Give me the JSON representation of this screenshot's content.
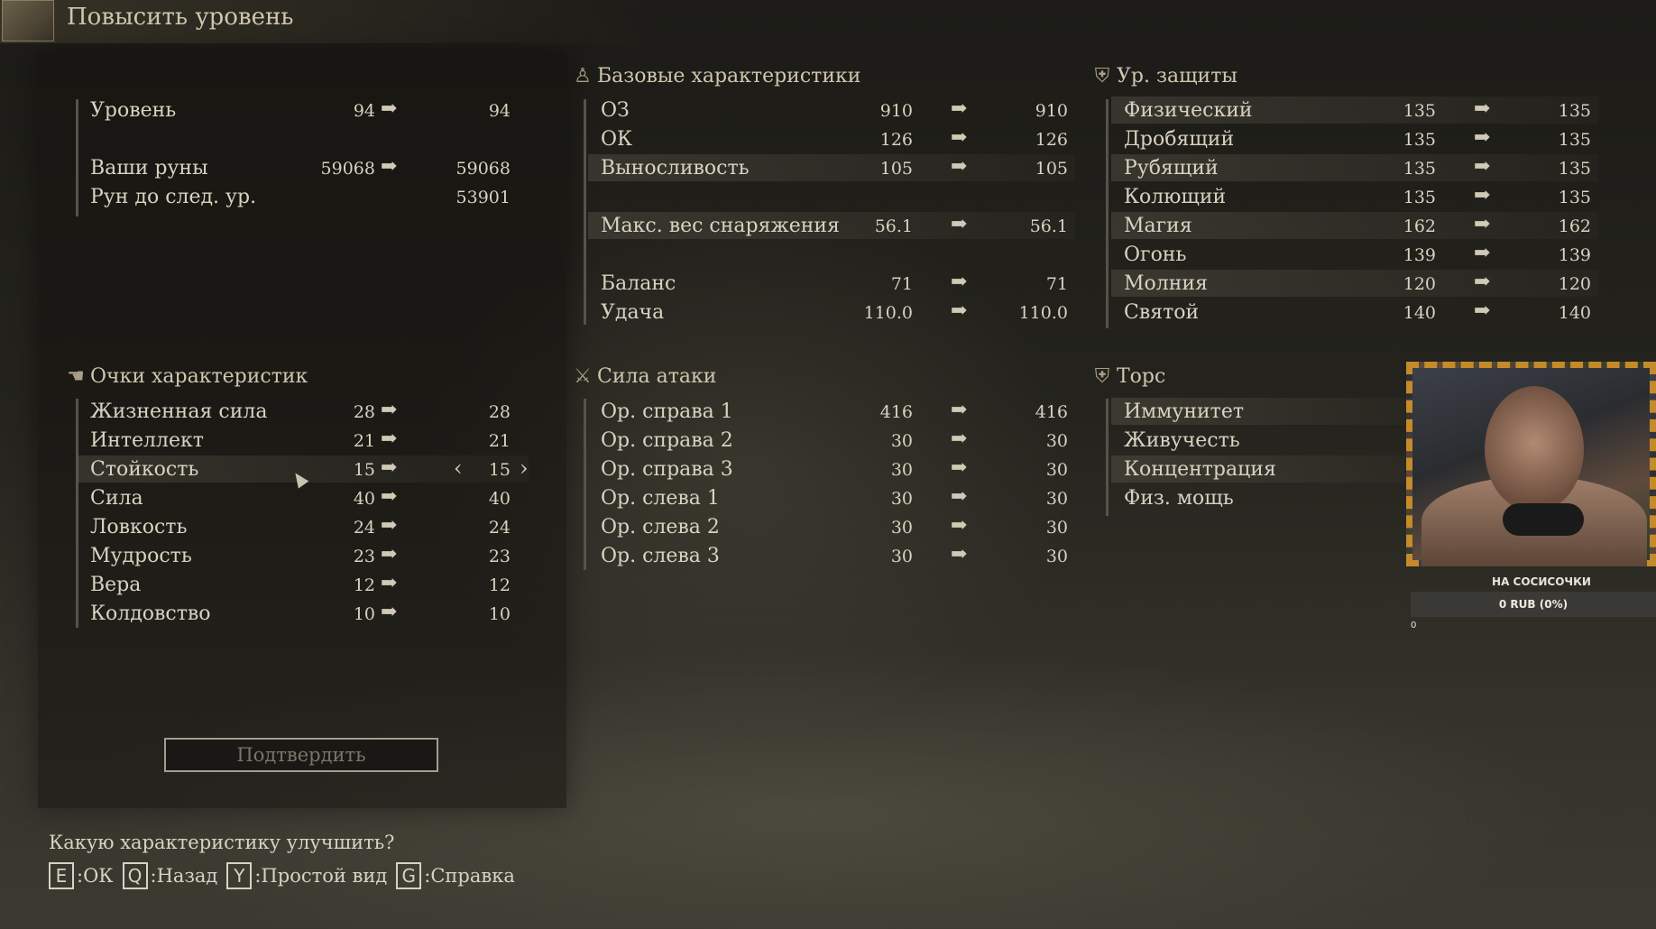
{
  "title": "Повысить уровень",
  "arrow": "➡",
  "level_section": {
    "rows": [
      {
        "label": "Уровень",
        "current": "94",
        "next": "94"
      },
      {
        "label": "Ваши руны",
        "current": "59068",
        "next": "59068"
      },
      {
        "label": "Рун до след. ур.",
        "next": "53901"
      }
    ]
  },
  "attributes": {
    "header": "Очки характеристик",
    "rows": [
      {
        "label": "Жизненная сила",
        "current": "28",
        "next": "28"
      },
      {
        "label": "Интеллект",
        "current": "21",
        "next": "21"
      },
      {
        "label": "Стойкость",
        "current": "15",
        "next": "15"
      },
      {
        "label": "Сила",
        "current": "40",
        "next": "40"
      },
      {
        "label": "Ловкость",
        "current": "24",
        "next": "24"
      },
      {
        "label": "Мудрость",
        "current": "23",
        "next": "23"
      },
      {
        "label": "Вера",
        "current": "12",
        "next": "12"
      },
      {
        "label": "Колдовство",
        "current": "10",
        "next": "10"
      }
    ],
    "selected_index": 2,
    "left_arrow": "‹",
    "right_arrow": "›"
  },
  "confirm_label": "Подтвердить",
  "base_stats": {
    "header": "Базовые характеристики",
    "rows": [
      {
        "label": "ОЗ",
        "current": "910",
        "next": "910"
      },
      {
        "label": "ОК",
        "current": "126",
        "next": "126"
      },
      {
        "label": "Выносливость",
        "current": "105",
        "next": "105"
      },
      {
        "label": "Макс. вес снаряжения",
        "current": "56.1",
        "next": "56.1"
      },
      {
        "label": "Баланс",
        "current": "71",
        "next": "71"
      },
      {
        "label": "Удача",
        "current": "110.0",
        "next": "110.0"
      }
    ]
  },
  "attack_power": {
    "header": "Сила атаки",
    "rows": [
      {
        "label": "Ор. справа 1",
        "current": "416",
        "next": "416"
      },
      {
        "label": "Ор. справа 2",
        "current": "30",
        "next": "30"
      },
      {
        "label": "Ор. справа 3",
        "current": "30",
        "next": "30"
      },
      {
        "label": "Ор. слева 1",
        "current": "30",
        "next": "30"
      },
      {
        "label": "Ор. слева 2",
        "current": "30",
        "next": "30"
      },
      {
        "label": "Ор. слева 3",
        "current": "30",
        "next": "30"
      }
    ]
  },
  "defense": {
    "header": "Ур. защиты",
    "rows": [
      {
        "label": "Физический",
        "current": "135",
        "next": "135"
      },
      {
        "label": "Дробящий",
        "current": "135",
        "next": "135"
      },
      {
        "label": "Рубящий",
        "current": "135",
        "next": "135"
      },
      {
        "label": "Колющий",
        "current": "135",
        "next": "135"
      },
      {
        "label": "Магия",
        "current": "162",
        "next": "162"
      },
      {
        "label": "Огонь",
        "current": "139",
        "next": "139"
      },
      {
        "label": "Молния",
        "current": "120",
        "next": "120"
      },
      {
        "label": "Святой",
        "current": "140",
        "next": "140"
      }
    ]
  },
  "torso": {
    "header": "Торс",
    "rows": [
      {
        "label": "Иммунитет"
      },
      {
        "label": "Живучесть"
      },
      {
        "label": "Концентрация"
      },
      {
        "label": "Физ. мощь"
      }
    ]
  },
  "prompt": "Какую характеристику улучшить?",
  "key_hints": [
    {
      "key": "E",
      "label": ":ОК"
    },
    {
      "key": "Q",
      "label": ":Назад"
    },
    {
      "key": "Y",
      "label": ":Простой вид"
    },
    {
      "key": "G",
      "label": ":Справка"
    }
  ],
  "stream_overlay": {
    "donation_title": "НА СОСИСОЧКИ",
    "donation_amount": "0 RUB (0%)",
    "donation_count": "0"
  }
}
